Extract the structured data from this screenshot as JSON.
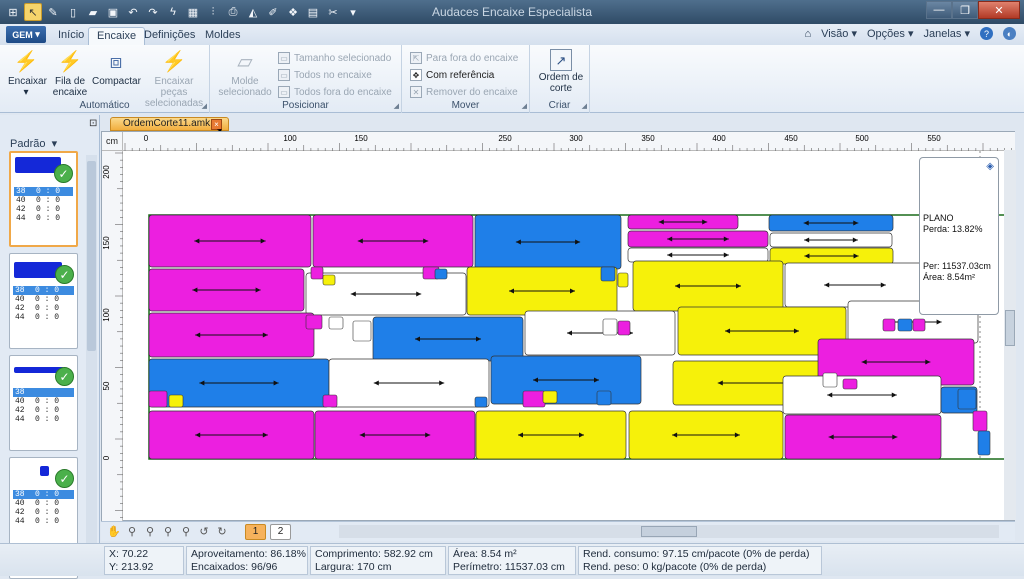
{
  "window": {
    "title": "Audaces Encaixe Especialista"
  },
  "app_button": "GEM",
  "ribbon_tabs": [
    "Início",
    "Encaixe",
    "Definições",
    "Moldes"
  ],
  "ribbon_right": {
    "visao": "Visão",
    "opcoes": "Opções",
    "janelas": "Janelas"
  },
  "groups": {
    "automatico": {
      "label": "Automático",
      "encaixar": "Encaixar",
      "fila": "Fila de encaixe",
      "compactar": "Compactar",
      "encaixar_pecas": "Encaixar peças selecionadas"
    },
    "posicionar": {
      "label": "Posicionar",
      "molde": "Molde selecionado",
      "tamanho": "Tamanho selecionado",
      "todos_no": "Todos no encaixe",
      "todos_fora": "Todos fora do encaixe"
    },
    "mover": {
      "label": "Mover",
      "para_fora": "Para fora do encaixe",
      "com_ref": "Com referência",
      "remover": "Remover do encaixe"
    },
    "criar": {
      "label": "Criar",
      "ordem": "Ordem de corte"
    }
  },
  "left_panel": {
    "header": "Padrão"
  },
  "patterns": [
    {
      "sizes": [
        {
          "size": "38",
          "value": "0 : 0"
        },
        {
          "size": "40",
          "value": "0 : 0"
        },
        {
          "size": "42",
          "value": "0 : 0"
        },
        {
          "size": "44",
          "value": "0 : 0"
        }
      ]
    },
    {
      "sizes": [
        {
          "size": "38",
          "value": "0 : 0"
        },
        {
          "size": "40",
          "value": "0 : 0"
        },
        {
          "size": "42",
          "value": "0 : 0"
        },
        {
          "size": "44",
          "value": "0 : 0"
        }
      ]
    },
    {
      "sizes": [
        {
          "size": "38",
          "value": ""
        },
        {
          "size": "40",
          "value": "0 : 0"
        },
        {
          "size": "42",
          "value": "0 : 0"
        },
        {
          "size": "44",
          "value": "0 : 0"
        }
      ]
    },
    {
      "sizes": [
        {
          "size": "38",
          "value": "0 : 0"
        },
        {
          "size": "40",
          "value": "0 : 0"
        },
        {
          "size": "42",
          "value": "0 : 0"
        },
        {
          "size": "44",
          "value": "0 : 0"
        }
      ]
    }
  ],
  "document_tab": "OrdemCorte11.amk",
  "ruler": {
    "unit": "cm",
    "top": [
      0,
      100,
      150,
      250,
      300,
      350,
      400,
      450,
      500,
      550
    ],
    "left": [
      200,
      150,
      100,
      50,
      0
    ]
  },
  "info_box": {
    "plano": "PLANO",
    "perda": "Perda: 13.82%",
    "per": "Per: 11537.03cm",
    "area": "Área: 8.54m²"
  },
  "pages": [
    "1",
    "2"
  ],
  "status": {
    "x": "X: 70.22",
    "y": "Y: 213.92",
    "aproveitamento": "Aproveitamento: 86.18%",
    "encaixados": "Encaixados: 96/96",
    "comprimento": "Comprimento: 582.92 cm",
    "largura": "Largura: 170 cm",
    "area": "Área: 8.54 m²",
    "perimetro": "Perímetro: 11537.03 cm",
    "rend_consumo": "Rend. consumo: 97.15 cm/pacote (0% de perda)",
    "rend_peso": "Rend. peso: 0 kg/pacote (0% de perda)"
  },
  "colors": {
    "magenta": "#ec1fe0",
    "blue": "#1f7fe8",
    "yellow": "#f6f10a",
    "white": "#ffffff"
  }
}
